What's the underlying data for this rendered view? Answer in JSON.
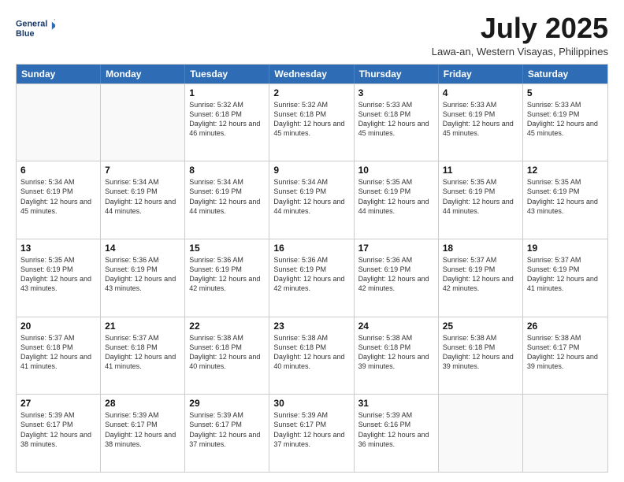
{
  "logo": {
    "line1": "General",
    "line2": "Blue"
  },
  "title": "July 2025",
  "subtitle": "Lawa-an, Western Visayas, Philippines",
  "day_headers": [
    "Sunday",
    "Monday",
    "Tuesday",
    "Wednesday",
    "Thursday",
    "Friday",
    "Saturday"
  ],
  "weeks": [
    [
      {
        "num": "",
        "sunrise": "",
        "sunset": "",
        "daylight": "",
        "empty": true
      },
      {
        "num": "",
        "sunrise": "",
        "sunset": "",
        "daylight": "",
        "empty": true
      },
      {
        "num": "1",
        "sunrise": "Sunrise: 5:32 AM",
        "sunset": "Sunset: 6:18 PM",
        "daylight": "Daylight: 12 hours and 46 minutes.",
        "empty": false
      },
      {
        "num": "2",
        "sunrise": "Sunrise: 5:32 AM",
        "sunset": "Sunset: 6:18 PM",
        "daylight": "Daylight: 12 hours and 45 minutes.",
        "empty": false
      },
      {
        "num": "3",
        "sunrise": "Sunrise: 5:33 AM",
        "sunset": "Sunset: 6:18 PM",
        "daylight": "Daylight: 12 hours and 45 minutes.",
        "empty": false
      },
      {
        "num": "4",
        "sunrise": "Sunrise: 5:33 AM",
        "sunset": "Sunset: 6:19 PM",
        "daylight": "Daylight: 12 hours and 45 minutes.",
        "empty": false
      },
      {
        "num": "5",
        "sunrise": "Sunrise: 5:33 AM",
        "sunset": "Sunset: 6:19 PM",
        "daylight": "Daylight: 12 hours and 45 minutes.",
        "empty": false
      }
    ],
    [
      {
        "num": "6",
        "sunrise": "Sunrise: 5:34 AM",
        "sunset": "Sunset: 6:19 PM",
        "daylight": "Daylight: 12 hours and 45 minutes.",
        "empty": false
      },
      {
        "num": "7",
        "sunrise": "Sunrise: 5:34 AM",
        "sunset": "Sunset: 6:19 PM",
        "daylight": "Daylight: 12 hours and 44 minutes.",
        "empty": false
      },
      {
        "num": "8",
        "sunrise": "Sunrise: 5:34 AM",
        "sunset": "Sunset: 6:19 PM",
        "daylight": "Daylight: 12 hours and 44 minutes.",
        "empty": false
      },
      {
        "num": "9",
        "sunrise": "Sunrise: 5:34 AM",
        "sunset": "Sunset: 6:19 PM",
        "daylight": "Daylight: 12 hours and 44 minutes.",
        "empty": false
      },
      {
        "num": "10",
        "sunrise": "Sunrise: 5:35 AM",
        "sunset": "Sunset: 6:19 PM",
        "daylight": "Daylight: 12 hours and 44 minutes.",
        "empty": false
      },
      {
        "num": "11",
        "sunrise": "Sunrise: 5:35 AM",
        "sunset": "Sunset: 6:19 PM",
        "daylight": "Daylight: 12 hours and 44 minutes.",
        "empty": false
      },
      {
        "num": "12",
        "sunrise": "Sunrise: 5:35 AM",
        "sunset": "Sunset: 6:19 PM",
        "daylight": "Daylight: 12 hours and 43 minutes.",
        "empty": false
      }
    ],
    [
      {
        "num": "13",
        "sunrise": "Sunrise: 5:35 AM",
        "sunset": "Sunset: 6:19 PM",
        "daylight": "Daylight: 12 hours and 43 minutes.",
        "empty": false
      },
      {
        "num": "14",
        "sunrise": "Sunrise: 5:36 AM",
        "sunset": "Sunset: 6:19 PM",
        "daylight": "Daylight: 12 hours and 43 minutes.",
        "empty": false
      },
      {
        "num": "15",
        "sunrise": "Sunrise: 5:36 AM",
        "sunset": "Sunset: 6:19 PM",
        "daylight": "Daylight: 12 hours and 42 minutes.",
        "empty": false
      },
      {
        "num": "16",
        "sunrise": "Sunrise: 5:36 AM",
        "sunset": "Sunset: 6:19 PM",
        "daylight": "Daylight: 12 hours and 42 minutes.",
        "empty": false
      },
      {
        "num": "17",
        "sunrise": "Sunrise: 5:36 AM",
        "sunset": "Sunset: 6:19 PM",
        "daylight": "Daylight: 12 hours and 42 minutes.",
        "empty": false
      },
      {
        "num": "18",
        "sunrise": "Sunrise: 5:37 AM",
        "sunset": "Sunset: 6:19 PM",
        "daylight": "Daylight: 12 hours and 42 minutes.",
        "empty": false
      },
      {
        "num": "19",
        "sunrise": "Sunrise: 5:37 AM",
        "sunset": "Sunset: 6:19 PM",
        "daylight": "Daylight: 12 hours and 41 minutes.",
        "empty": false
      }
    ],
    [
      {
        "num": "20",
        "sunrise": "Sunrise: 5:37 AM",
        "sunset": "Sunset: 6:18 PM",
        "daylight": "Daylight: 12 hours and 41 minutes.",
        "empty": false
      },
      {
        "num": "21",
        "sunrise": "Sunrise: 5:37 AM",
        "sunset": "Sunset: 6:18 PM",
        "daylight": "Daylight: 12 hours and 41 minutes.",
        "empty": false
      },
      {
        "num": "22",
        "sunrise": "Sunrise: 5:38 AM",
        "sunset": "Sunset: 6:18 PM",
        "daylight": "Daylight: 12 hours and 40 minutes.",
        "empty": false
      },
      {
        "num": "23",
        "sunrise": "Sunrise: 5:38 AM",
        "sunset": "Sunset: 6:18 PM",
        "daylight": "Daylight: 12 hours and 40 minutes.",
        "empty": false
      },
      {
        "num": "24",
        "sunrise": "Sunrise: 5:38 AM",
        "sunset": "Sunset: 6:18 PM",
        "daylight": "Daylight: 12 hours and 39 minutes.",
        "empty": false
      },
      {
        "num": "25",
        "sunrise": "Sunrise: 5:38 AM",
        "sunset": "Sunset: 6:18 PM",
        "daylight": "Daylight: 12 hours and 39 minutes.",
        "empty": false
      },
      {
        "num": "26",
        "sunrise": "Sunrise: 5:38 AM",
        "sunset": "Sunset: 6:17 PM",
        "daylight": "Daylight: 12 hours and 39 minutes.",
        "empty": false
      }
    ],
    [
      {
        "num": "27",
        "sunrise": "Sunrise: 5:39 AM",
        "sunset": "Sunset: 6:17 PM",
        "daylight": "Daylight: 12 hours and 38 minutes.",
        "empty": false
      },
      {
        "num": "28",
        "sunrise": "Sunrise: 5:39 AM",
        "sunset": "Sunset: 6:17 PM",
        "daylight": "Daylight: 12 hours and 38 minutes.",
        "empty": false
      },
      {
        "num": "29",
        "sunrise": "Sunrise: 5:39 AM",
        "sunset": "Sunset: 6:17 PM",
        "daylight": "Daylight: 12 hours and 37 minutes.",
        "empty": false
      },
      {
        "num": "30",
        "sunrise": "Sunrise: 5:39 AM",
        "sunset": "Sunset: 6:17 PM",
        "daylight": "Daylight: 12 hours and 37 minutes.",
        "empty": false
      },
      {
        "num": "31",
        "sunrise": "Sunrise: 5:39 AM",
        "sunset": "Sunset: 6:16 PM",
        "daylight": "Daylight: 12 hours and 36 minutes.",
        "empty": false
      },
      {
        "num": "",
        "sunrise": "",
        "sunset": "",
        "daylight": "",
        "empty": true
      },
      {
        "num": "",
        "sunrise": "",
        "sunset": "",
        "daylight": "",
        "empty": true
      }
    ]
  ]
}
